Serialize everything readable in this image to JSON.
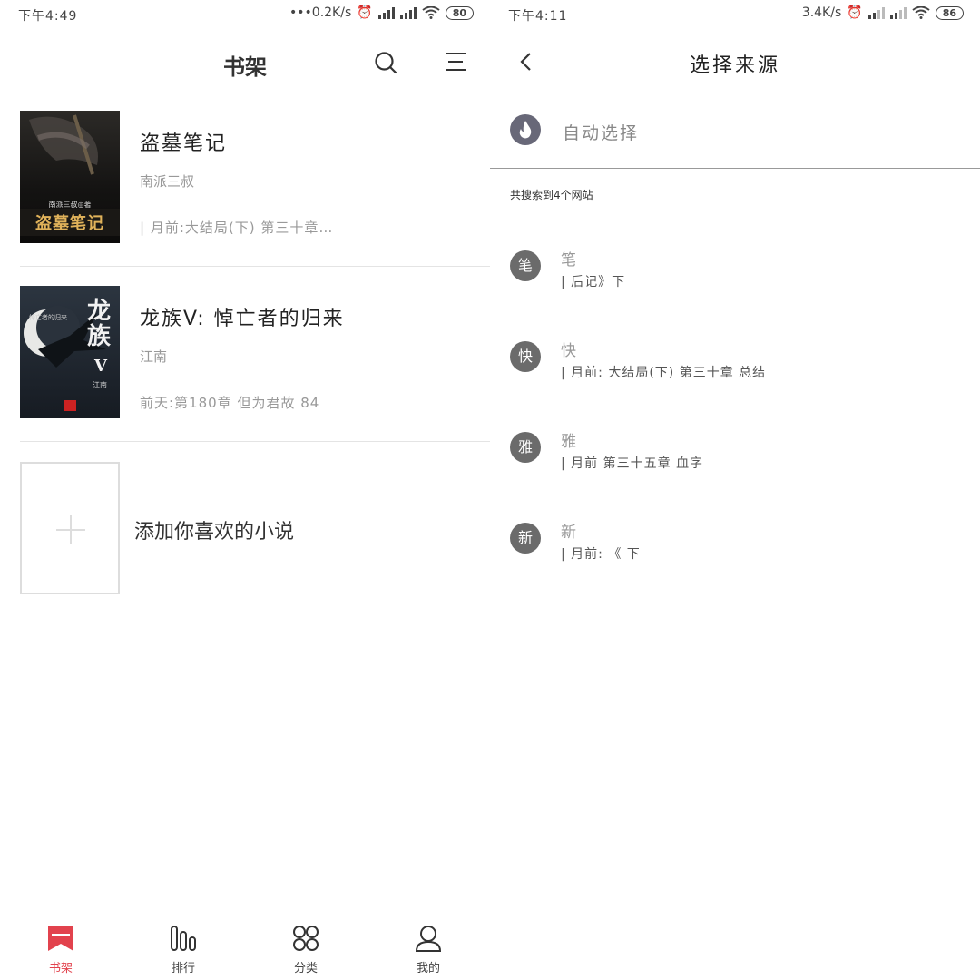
{
  "left": {
    "status": {
      "time": "下午4:49",
      "speed": "•••0.2K/s",
      "battery": "80"
    },
    "header": {
      "title": "书架"
    },
    "books": [
      {
        "name": "盗墓笔记",
        "author": "南派三叔",
        "latest": "| 月前:大结局(下) 第三十章…",
        "cover_title": "盗墓笔记",
        "cover_author": "南派三叔◎著"
      },
      {
        "name": "龙族V: 悼亡者的归来",
        "author": "江南",
        "latest": "前天:第180章 但为君故 84",
        "cover_title": "龙族",
        "cover_sub": "V",
        "cover_tag": "悼亡者的归来",
        "cover_author": "江南"
      }
    ],
    "add_label": "添加你喜欢的小说",
    "tabs": [
      {
        "label": "书架",
        "icon": "bookmark-icon"
      },
      {
        "label": "排行",
        "icon": "rank-bars-icon"
      },
      {
        "label": "分类",
        "icon": "grid-circles-icon"
      },
      {
        "label": "我的",
        "icon": "user-icon"
      }
    ],
    "accent": "#e2424d"
  },
  "right": {
    "status": {
      "time": "下午4:11",
      "speed": "3.4K/s",
      "battery": "86"
    },
    "nav": {
      "title": "选择来源"
    },
    "auto": {
      "label": "自动选择"
    },
    "found": "共搜索到4个网站",
    "sources": [
      {
        "badge": "笔",
        "name": "笔",
        "latest": "|         后记》下"
      },
      {
        "badge": "快",
        "name": "快",
        "latest": "| 月前:  大结局(下) 第三十章 总结"
      },
      {
        "badge": "雅",
        "name": "雅",
        "latest": "| 月前          第三十五章 血字"
      },
      {
        "badge": "新",
        "name": "新",
        "latest": "| 月前: 《        下"
      }
    ]
  }
}
